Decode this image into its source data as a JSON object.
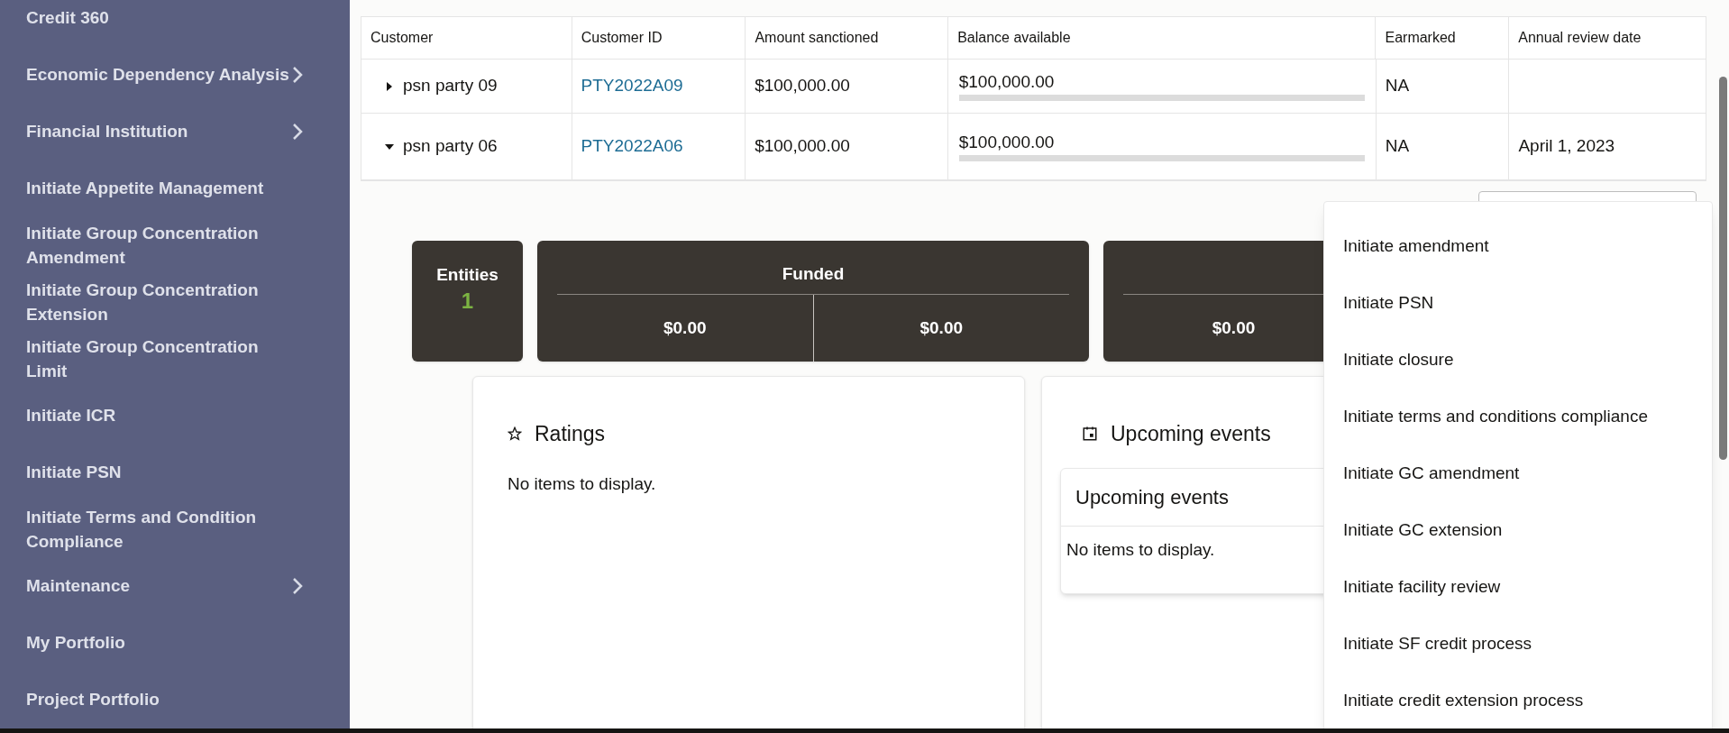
{
  "sidebar": {
    "items": [
      {
        "label": "Credit 360",
        "has_submenu": false
      },
      {
        "label": "Economic Dependency Analysis",
        "has_submenu": true
      },
      {
        "label": "Financial Institution",
        "has_submenu": true
      },
      {
        "label": "Initiate Appetite Management",
        "has_submenu": false
      },
      {
        "label": "Initiate Group Concentration Amendment",
        "has_submenu": false
      },
      {
        "label": "Initiate Group Concentration Extension",
        "has_submenu": false
      },
      {
        "label": "Initiate Group Concentration Limit",
        "has_submenu": false
      },
      {
        "label": "Initiate ICR",
        "has_submenu": false
      },
      {
        "label": "Initiate PSN",
        "has_submenu": false
      },
      {
        "label": "Initiate Terms and Condition Compliance",
        "has_submenu": false
      },
      {
        "label": "Maintenance",
        "has_submenu": true
      },
      {
        "label": "My Portfolio",
        "has_submenu": false
      },
      {
        "label": "Project Portfolio",
        "has_submenu": false
      }
    ]
  },
  "table": {
    "columns": [
      "Customer",
      "Customer ID",
      "Amount sanctioned",
      "Balance available",
      "Earmarked",
      "Annual review date"
    ],
    "rows": [
      {
        "customer": "psn party 09",
        "expanded": false,
        "customer_id": "PTY2022A09",
        "amount_sanctioned": "$100,000.00",
        "balance_available": "$100,000.00",
        "earmarked": "NA",
        "annual_review_date": ""
      },
      {
        "customer": "psn party 06",
        "expanded": true,
        "customer_id": "PTY2022A06",
        "amount_sanctioned": "$100,000.00",
        "balance_available": "$100,000.00",
        "earmarked": "NA",
        "annual_review_date": "April 1, 2023"
      }
    ]
  },
  "summary_cards": [
    {
      "kind": "count",
      "title": "Entities",
      "value": "1"
    },
    {
      "kind": "split",
      "title": "Funded",
      "values": [
        "$0.00",
        "$0.00"
      ]
    },
    {
      "kind": "split",
      "values": [
        "$0.00"
      ]
    }
  ],
  "panels": [
    {
      "kind": "ratings",
      "title": "Ratings",
      "empty_text": "No items to display."
    },
    {
      "kind": "events",
      "title": "Upcoming events",
      "inner_title": "Upcoming events",
      "empty_text": "No items to display."
    }
  ],
  "actions_menu": {
    "items": [
      "Initiate amendment",
      "Initiate PSN",
      "Initiate closure",
      "Initiate terms and conditions compliance",
      "Initiate GC amendment",
      "Initiate GC extension",
      "Initiate facility review",
      "Initiate SF credit process",
      "Initiate credit extension process"
    ]
  }
}
